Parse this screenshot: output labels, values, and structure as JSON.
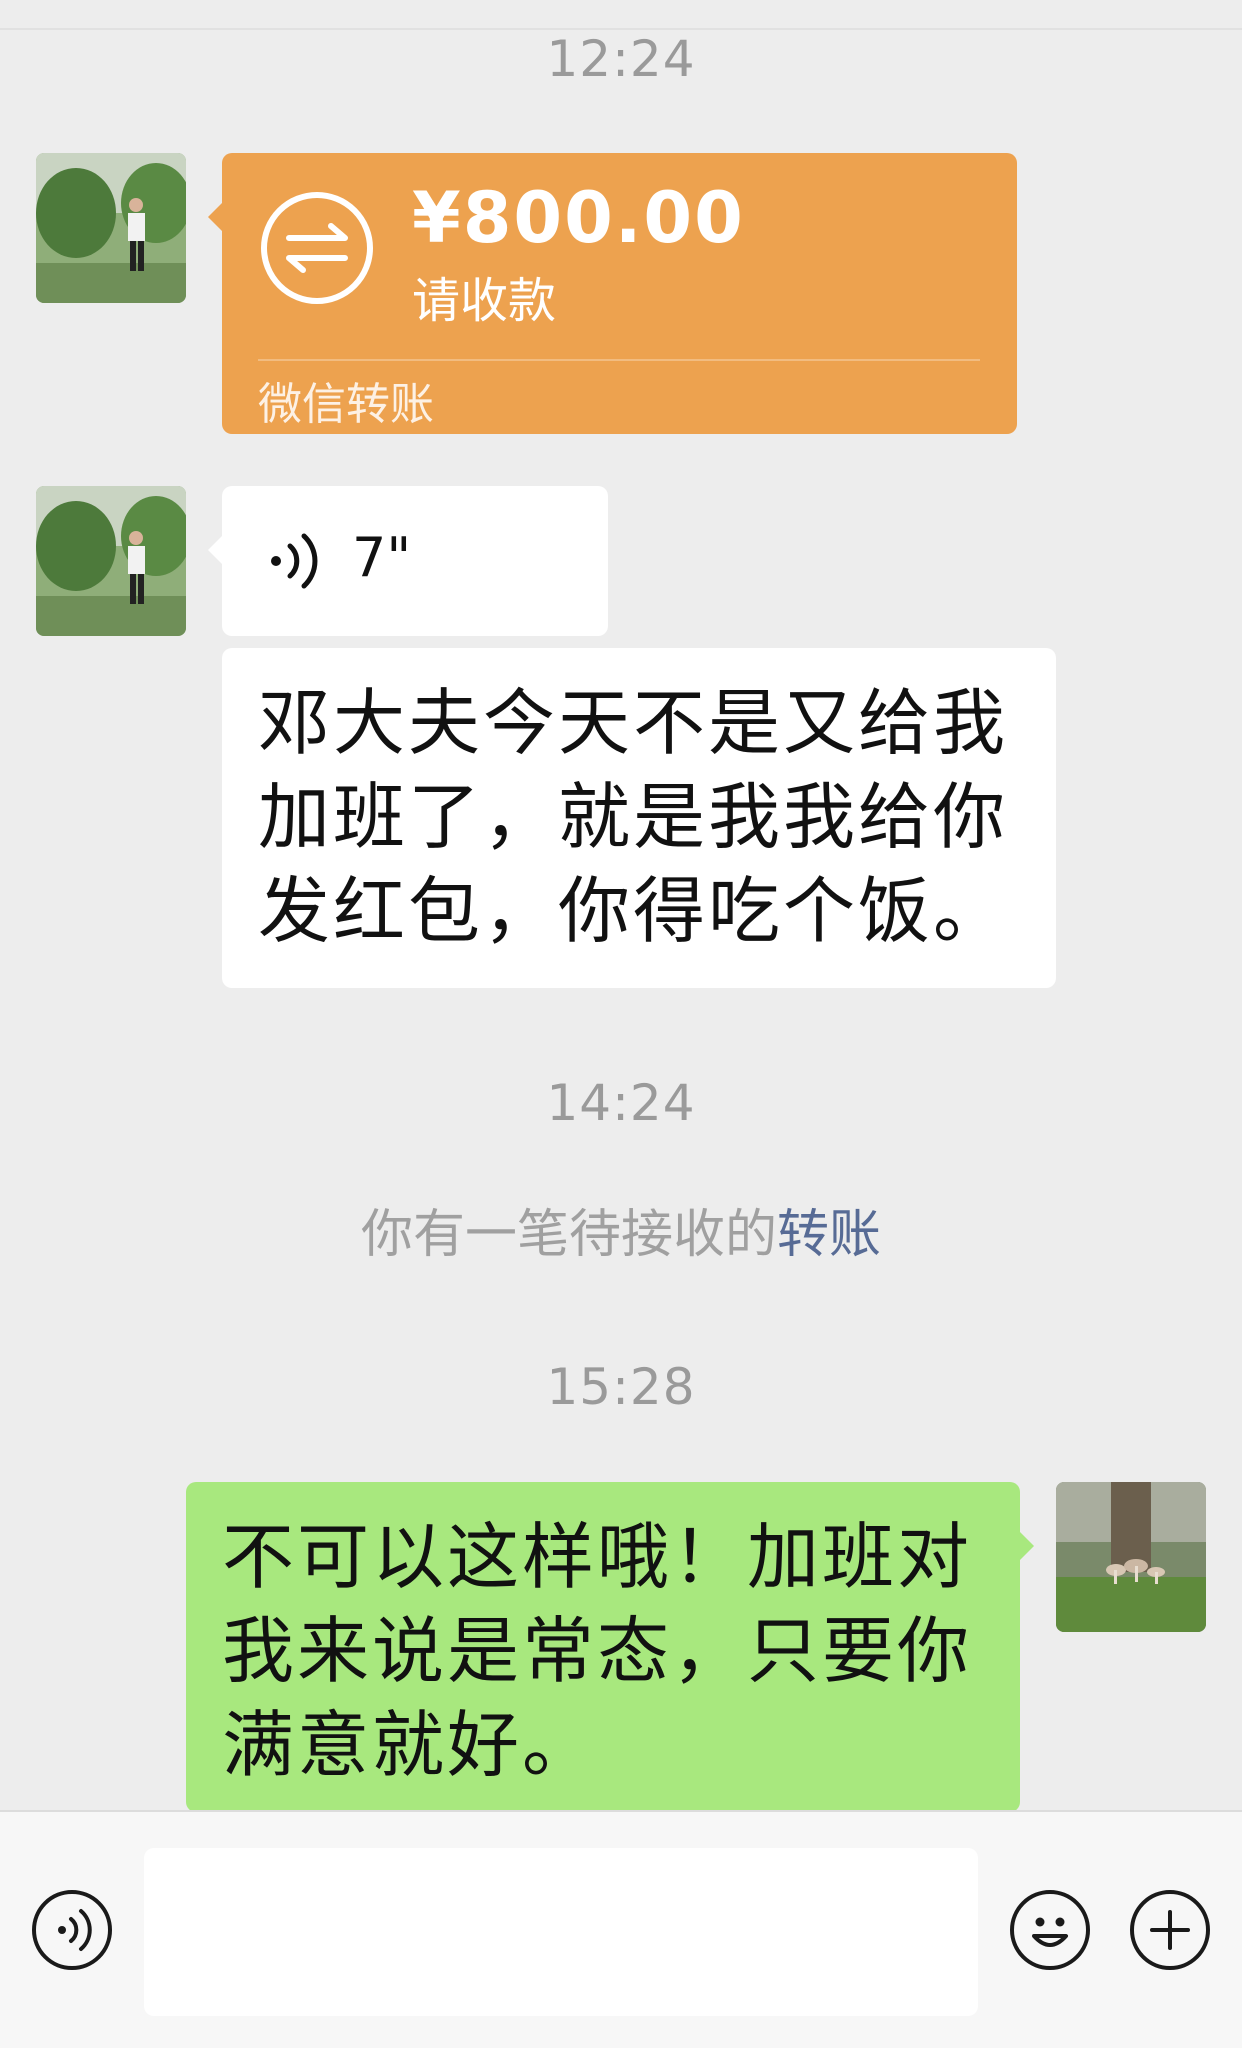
{
  "messages": {
    "time_1": "12:24",
    "transfer": {
      "amount": "¥800.00",
      "status": "请收款",
      "footer": "微信转账"
    },
    "voice": {
      "duration": "7\""
    },
    "text_in": "邓大夫今天不是又给我\n加班了，就是我我给你\n发红包，你得吃个饭。",
    "time_2": "14:24",
    "system_notice": {
      "prefix": "你有一笔待接收的",
      "link": "转账"
    },
    "time_3": "15:28",
    "text_out": "不可以这样哦！加班对\n我来说是常态，只要你\n满意就好。"
  },
  "input_bar": {
    "voice_icon": "voice-mode-icon",
    "emoji_icon": "emoji-icon",
    "plus_icon": "plus-icon",
    "value": ""
  },
  "colors": {
    "background": "#ededed",
    "transfer_bubble": "#eda24f",
    "outgoing_bubble": "#a8e87e",
    "incoming_bubble": "#ffffff",
    "link": "#576b95"
  }
}
